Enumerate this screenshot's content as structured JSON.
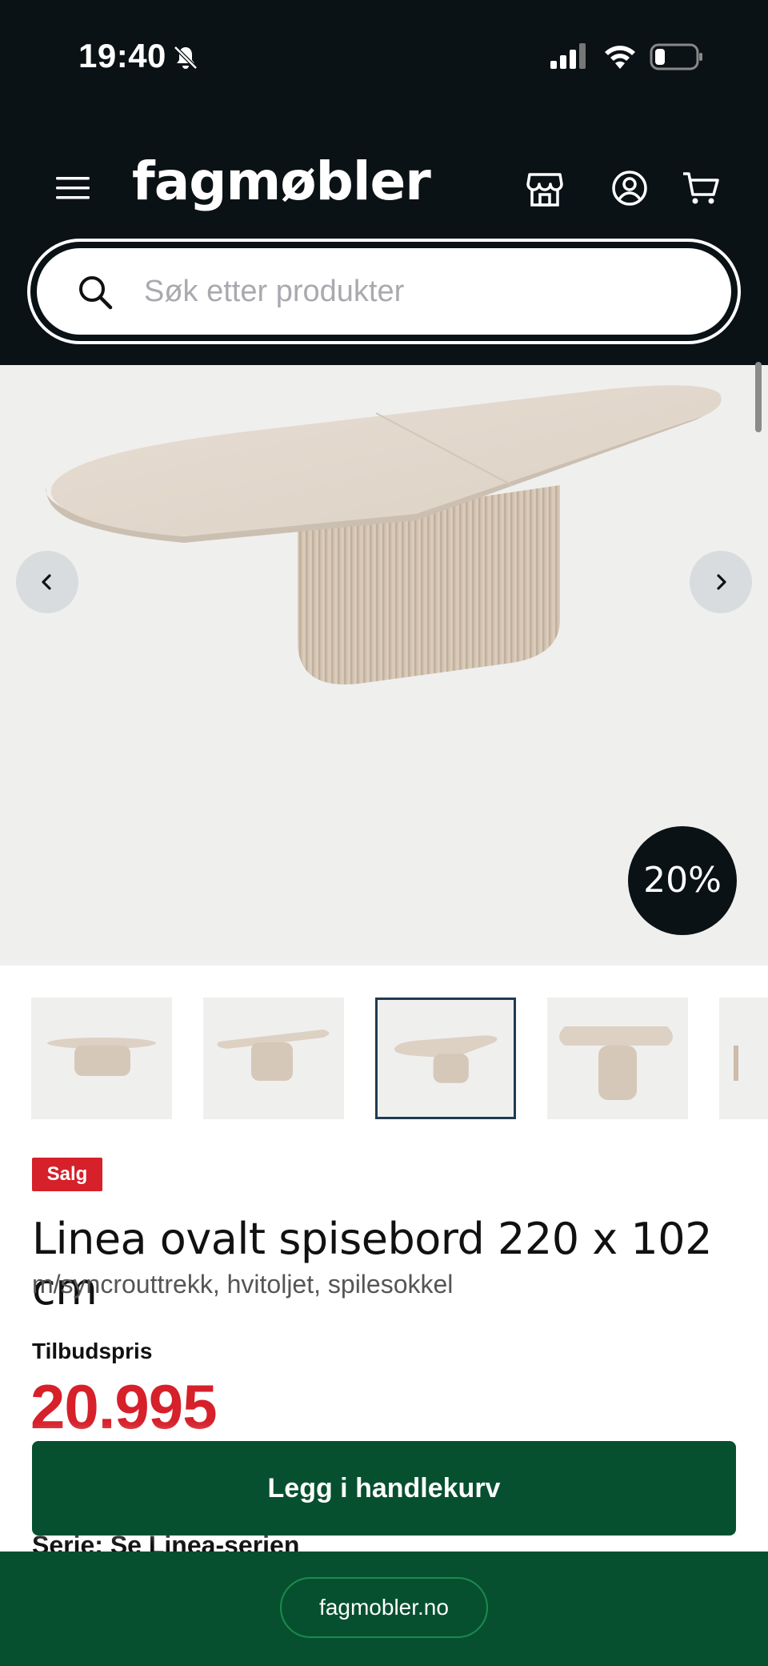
{
  "status_bar": {
    "time": "19:40"
  },
  "header": {
    "logo": "fagmøbler",
    "search_placeholder": "Søk etter produkter"
  },
  "gallery": {
    "discount_badge": "20%",
    "thumbnail_count": 5,
    "active_thumbnail": 3
  },
  "product": {
    "badge": "Salg",
    "title": "Linea ovalt spisebord 220 x 102 cm",
    "subtitle": "m/syncrouttrekk, hvitoljet, spilesokkel",
    "price_label": "Tilbudspris",
    "price": "20.995",
    "serie": "Serie: Se Linea-serien"
  },
  "actions": {
    "add_to_cart": "Legg i handlekurv"
  },
  "browser": {
    "url": "fagmobler.no"
  },
  "colors": {
    "header_bg": "#0b1216",
    "brand_green": "#06502f",
    "sale_red": "#d6202a"
  }
}
